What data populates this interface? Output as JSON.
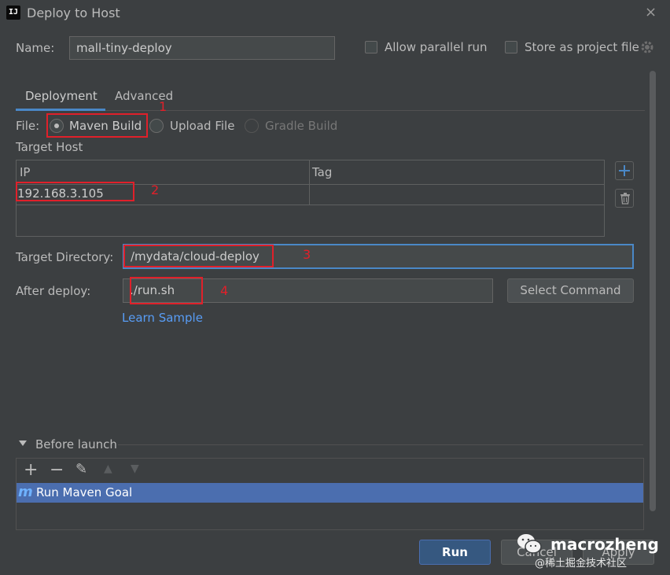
{
  "window": {
    "title": "Deploy to Host",
    "app_icon": "IJ",
    "close_glyph": "×"
  },
  "name_row": {
    "label": "Name:",
    "value": "mall-tiny-deploy"
  },
  "options": {
    "allow_parallel_run": "Allow parallel run",
    "store_as_project_file": "Store as project file"
  },
  "tabs": [
    {
      "label": "Deployment",
      "active": true
    },
    {
      "label": "Advanced",
      "active": false
    }
  ],
  "file_row": {
    "label": "File:",
    "choices": [
      {
        "label": "Maven Build",
        "selected": true
      },
      {
        "label": "Upload File",
        "selected": false
      },
      {
        "label": "Gradle Build",
        "selected": false,
        "disabled": true
      }
    ]
  },
  "target_host": {
    "label": "Target Host",
    "columns": [
      "IP",
      "Tag"
    ],
    "rows": [
      {
        "ip": "192.168.3.105",
        "tag": ""
      }
    ]
  },
  "target_directory": {
    "label": "Target Directory:",
    "value": "/mydata/cloud-deploy"
  },
  "after_deploy": {
    "label": "After deploy:",
    "value": "./run.sh",
    "select_button": "Select Command"
  },
  "learn_sample": "Learn Sample",
  "before_launch": {
    "label": "Before launch",
    "toolbar": {
      "add": "+",
      "remove": "−",
      "edit": "✎",
      "up": "▲",
      "down": "▼"
    },
    "items": [
      {
        "icon": "m",
        "label": "Run Maven Goal"
      }
    ]
  },
  "annotations": [
    "1",
    "2",
    "3",
    "4"
  ],
  "buttons": {
    "run": "Run",
    "cancel": "Cancel",
    "apply": "Apply"
  },
  "watermark": {
    "brand": "macrozheng",
    "sub": "@稀土掘金技术社区"
  },
  "colors": {
    "background": "#3c3f41",
    "accent": "#4a88c7",
    "selection": "#4b6eaf",
    "annotation": "#e0202a"
  }
}
